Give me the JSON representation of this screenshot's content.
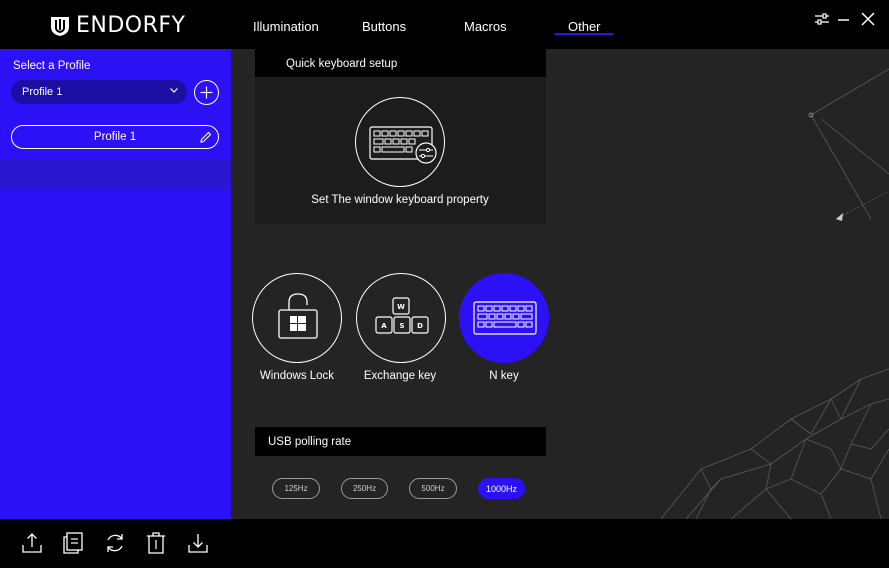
{
  "app": {
    "brand": "ENDORFY"
  },
  "nav": {
    "tabs": [
      {
        "label": "Illumination"
      },
      {
        "label": "Buttons"
      },
      {
        "label": "Macros"
      },
      {
        "label": "Other",
        "active": true
      }
    ]
  },
  "window_controls": [
    "settings-sliders-icon",
    "minimize-icon",
    "close-icon"
  ],
  "sidebar": {
    "title": "Select a Profile",
    "selected_profile": "Profile 1",
    "profile_name": "Profile 1"
  },
  "main": {
    "quick_setup": {
      "heading": "Quick keyboard setup",
      "item_label": "Set The window keyboard property"
    },
    "modes": [
      {
        "label": "Windows Lock",
        "icon": "unlocked-padlock-windows-icon",
        "active": false
      },
      {
        "label": "Exchange key",
        "icon": "wasd-keys-icon",
        "active": false
      },
      {
        "label": "N key",
        "icon": "keyboard-icon",
        "active": true
      }
    ],
    "polling": {
      "heading": "USB polling rate",
      "options": [
        "125Hz",
        "250Hz",
        "500Hz",
        "1000Hz"
      ],
      "selected": "1000Hz"
    }
  },
  "footer": {
    "icons": [
      "upload-icon",
      "document-icon",
      "refresh-icon",
      "delete-icon",
      "download-icon"
    ]
  },
  "colors": {
    "accent": "#2c10f6",
    "sidebar": "#2c10f6",
    "background": "#242424",
    "bar": "#000000"
  }
}
